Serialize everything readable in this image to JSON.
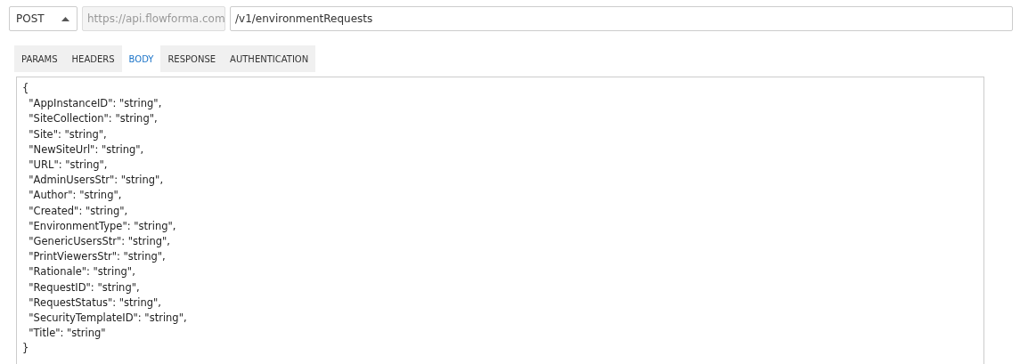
{
  "request": {
    "method": "POST",
    "base_url": "https://api.flowforma.com",
    "path": "/v1/environmentRequests"
  },
  "tabs": [
    {
      "label": "PARAMS",
      "selected": false
    },
    {
      "label": "HEADERS",
      "selected": false
    },
    {
      "label": "BODY",
      "selected": true
    },
    {
      "label": "RESPONSE",
      "selected": false
    },
    {
      "label": "AUTHENTICATION",
      "selected": false
    }
  ],
  "body_lines": [
    "{",
    "  \"AppInstanceID\": \"string\",",
    "  \"SiteCollection\": \"string\",",
    "  \"Site\": \"string\",",
    "  \"NewSiteUrl\": \"string\",",
    "  \"URL\": \"string\",",
    "  \"AdminUsersStr\": \"string\",",
    "  \"Author\": \"string\",",
    "  \"Created\": \"string\",",
    "  \"EnvironmentType\": \"string\",",
    "  \"GenericUsersStr\": \"string\",",
    "  \"PrintViewersStr\": \"string\",",
    "  \"Rationale\": \"string\",",
    "  \"RequestID\": \"string\",",
    "  \"RequestStatus\": \"string\",",
    "  \"SecurityTemplateID\": \"string\",",
    "  \"Title\": \"string\"",
    "}"
  ]
}
